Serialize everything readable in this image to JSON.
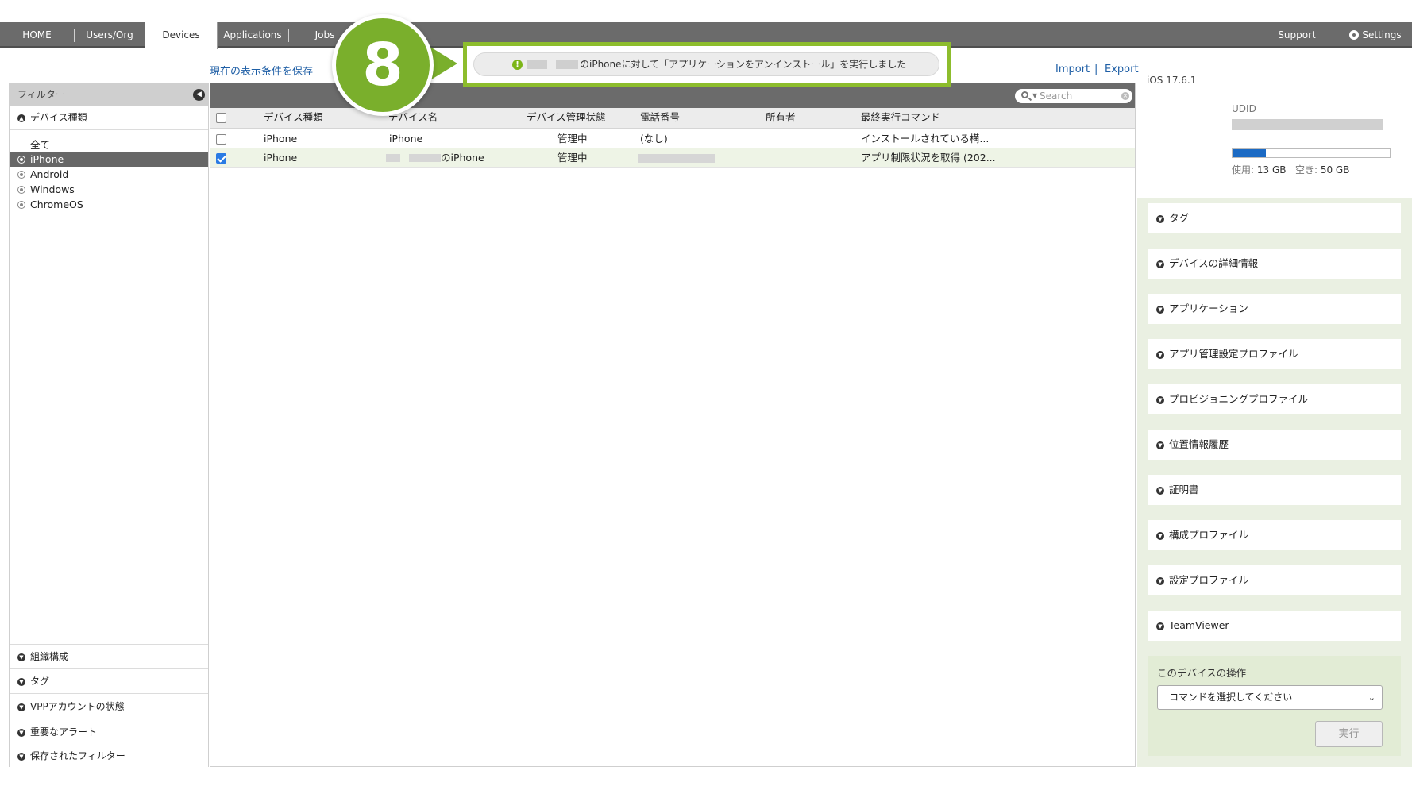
{
  "nav": {
    "tabs": [
      "HOME",
      "Users/Org",
      "Devices",
      "Applications",
      "Jobs"
    ],
    "active_tab": "Devices",
    "support": "Support",
    "settings": "Settings"
  },
  "toolbar": {
    "save_filter": "現在の表示条件を保存",
    "import": "Import",
    "export": "Export",
    "separator": "|"
  },
  "callout": {
    "step_number": "8",
    "message": "のiPhoneに対して「アプリケーションをアンインストール」を実行しました",
    "icon": "exclamation-icon",
    "accent_color": "#8dbd2d"
  },
  "filter": {
    "title": "フィルター",
    "device_type_section": "デバイス種類",
    "items": [
      "全て",
      "iPhone",
      "Android",
      "Windows",
      "ChromeOS"
    ],
    "selected": "iPhone",
    "bottom_sections": [
      "組織構成",
      "タグ",
      "VPPアカウントの状態",
      "重要なアラート",
      "保存されたフィルター"
    ]
  },
  "table": {
    "search_placeholder": "Search",
    "columns": [
      "デバイス種類",
      "デバイス名",
      "デバイス管理状態",
      "電話番号",
      "所有者",
      "最終実行コマンド"
    ],
    "rows": [
      {
        "checked": false,
        "type": "iPhone",
        "name": "iPhone",
        "status": "管理中",
        "phone": "(なし)",
        "owner": "",
        "last_command": "インストールされている構..."
      },
      {
        "checked": true,
        "type": "iPhone",
        "name": "のiPhone",
        "status": "管理中",
        "phone": "",
        "owner": "",
        "last_command": "アプリ制限状況を取得 (202..."
      }
    ]
  },
  "device_panel": {
    "os_version": "iOS 17.6.1",
    "udid_label": "UDID",
    "storage_used_label": "使用:",
    "storage_used": "13 GB",
    "storage_free_label": "空き:",
    "storage_free": "50 GB",
    "storage_used_fraction": 0.21,
    "sections": [
      "タグ",
      "デバイスの詳細情報",
      "アプリケーション",
      "アプリ管理設定プロファイル",
      "プロビジョニングプロファイル",
      "位置情報履歴",
      "証明書",
      "構成プロファイル",
      "設定プロファイル",
      "TeamViewer"
    ],
    "ops_title": "このデバイスの操作",
    "ops_select": "コマンドを選択してください",
    "ops_button": "実行"
  }
}
